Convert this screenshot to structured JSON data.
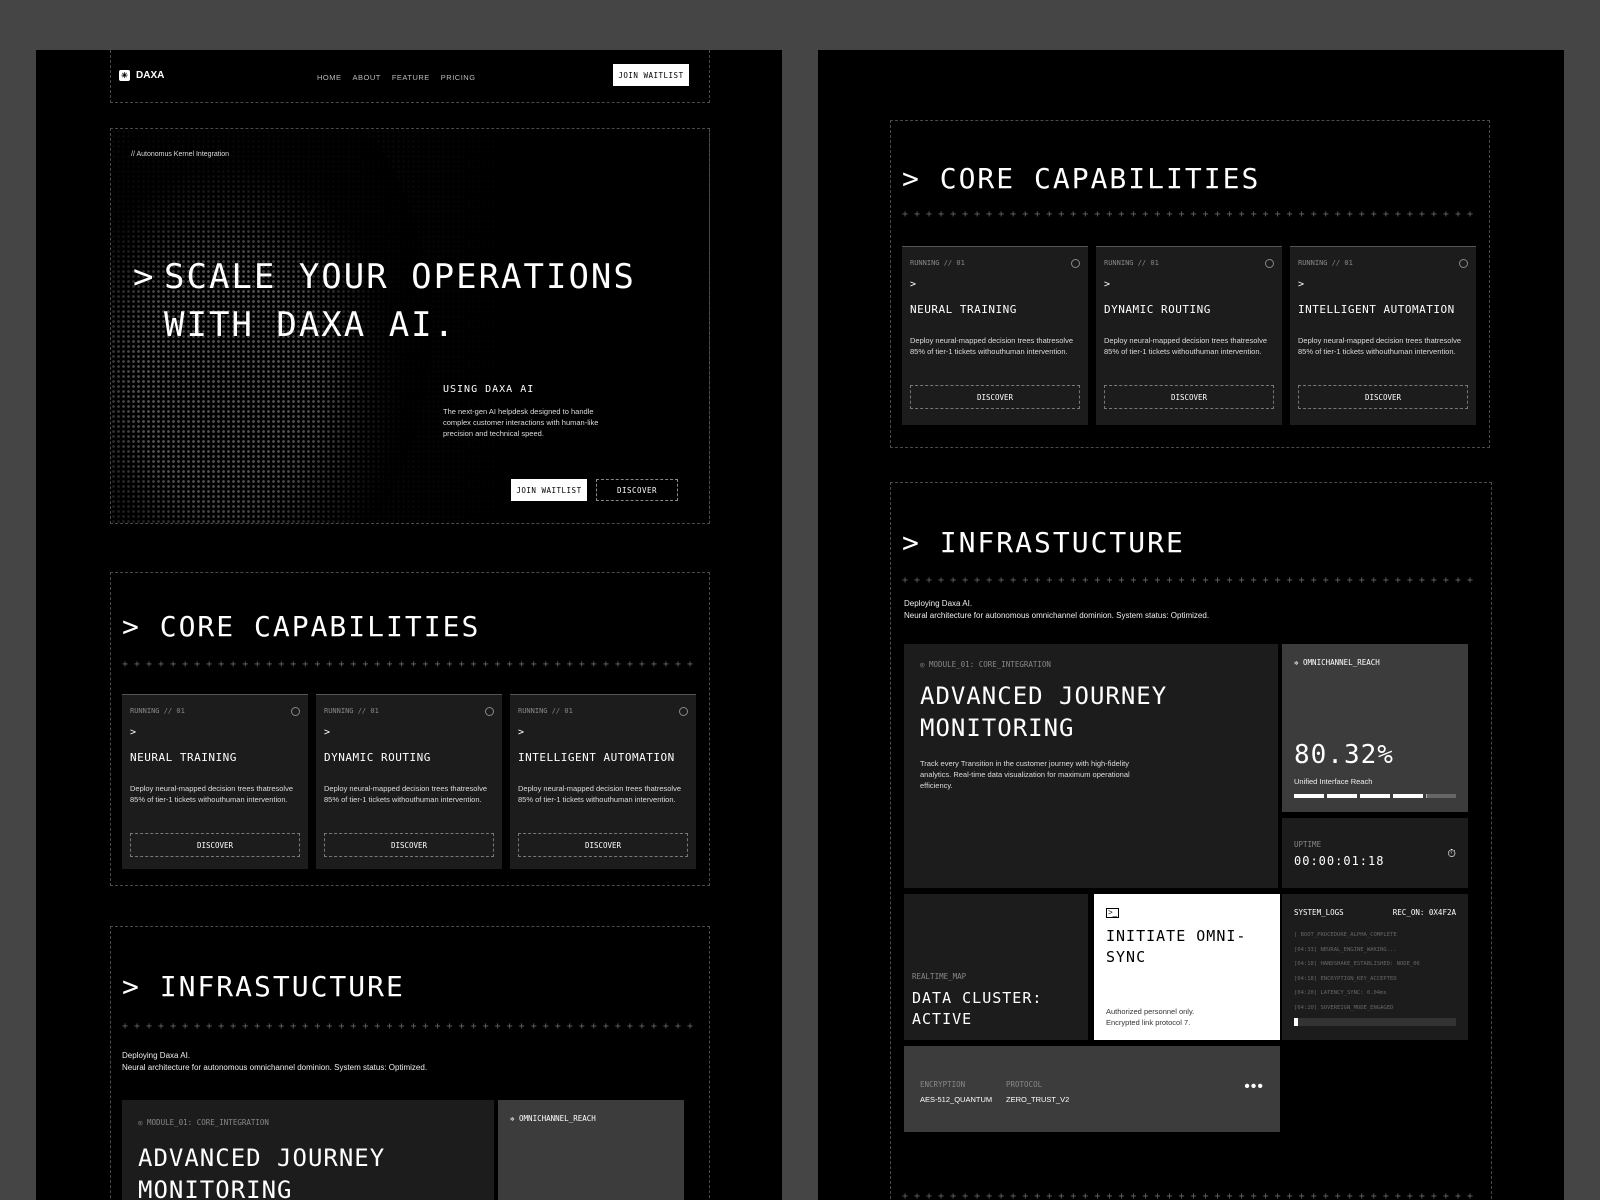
{
  "nav": {
    "brand": "DAXA",
    "links": [
      "HOME",
      "ABOUT",
      "FEATURE",
      "PRICING"
    ],
    "cta": "JOIN WAITLIST"
  },
  "hero": {
    "crumb": "// Autonomus Kernel Integration",
    "title_line1": "SCALE YOUR OPERATIONS",
    "title_line2": "WITH DAXA AI.",
    "sub_title": "USING DAXA AI",
    "sub_desc": "The next-gen AI helpdesk designed to handle complex customer interactions with human-like precision and technical speed.",
    "btn_primary": "JOIN WAITLIST",
    "btn_secondary": "DISCOVER"
  },
  "capabilities": {
    "title": "CORE CAPABILITIES",
    "cards": [
      {
        "status": "RUNNING // 01",
        "name": "NEURAL TRAINING",
        "desc": "Deploy neural-mapped decision trees thatresolve 85% of tier-1 tickets withouthuman intervention.",
        "button": "DISCOVER"
      },
      {
        "status": "RUNNING // 01",
        "name": "DYNAMIC ROUTING",
        "desc": "Deploy neural-mapped decision trees thatresolve 85% of tier-1 tickets withouthuman intervention.",
        "button": "DISCOVER"
      },
      {
        "status": "RUNNING // 01",
        "name": "INTELLIGENT AUTOMATION",
        "desc": "Deploy neural-mapped decision trees thatresolve 85% of tier-1 tickets withouthuman intervention.",
        "button": "DISCOVER"
      }
    ]
  },
  "infra": {
    "title": "INFRASTUCTURE",
    "intro_1": "Deploying Daxa AI.",
    "intro_2": "Neural architecture for autonomous omnichannel dominion. System status: Optimized.",
    "journey": {
      "module": "MODULE_01: CORE_INTEGRATION",
      "title": "ADVANCED JOURNEY\nMONITORING",
      "desc": "Track every Transition in the customer journey with high-fidelity analytics. Real-time data visualization for maximum operational efficiency."
    },
    "reach": {
      "label": "OMNICHANNEL_REACH",
      "value": "80.32%",
      "caption": "Unified Interface Reach",
      "progress": 0.8032
    },
    "uptime": {
      "label": "UPTIME",
      "value": "00:00:01:18"
    },
    "map": {
      "label": "REALTIME_MAP",
      "title": "DATA CLUSTER:\nACTIVE"
    },
    "sync": {
      "title": "INITIATE OMNI-\nSYNC",
      "note_1": "Authorized personnel only.",
      "note_2": "Encrypted link protocol 7."
    },
    "logs": {
      "label": "SYSTEM_LOGS",
      "rec": "REC_ON: 0X4F2A",
      "lines": [
        "[ BOOT_PROCEDURE_ALPHA_COMPLETE",
        "[04:33] NEURAL_ENGINE_WAKING...",
        "[04:18] HANDSHAKE_ESTABLISHED: NODE_06",
        "[04:18] ENCRYPTION_KEY_ACCEPTED",
        "[04:20] LATENCY_SYNC: 0.04ms",
        "[04:20] SOVEREIGN_MODE_ENGAGED"
      ]
    },
    "security": {
      "enc_label": "ENCRYPTION",
      "enc_value": "AES-512_QUANTUM",
      "proto_label": "PROTOCOL",
      "proto_value": "ZERO_TRUST_V2"
    }
  }
}
